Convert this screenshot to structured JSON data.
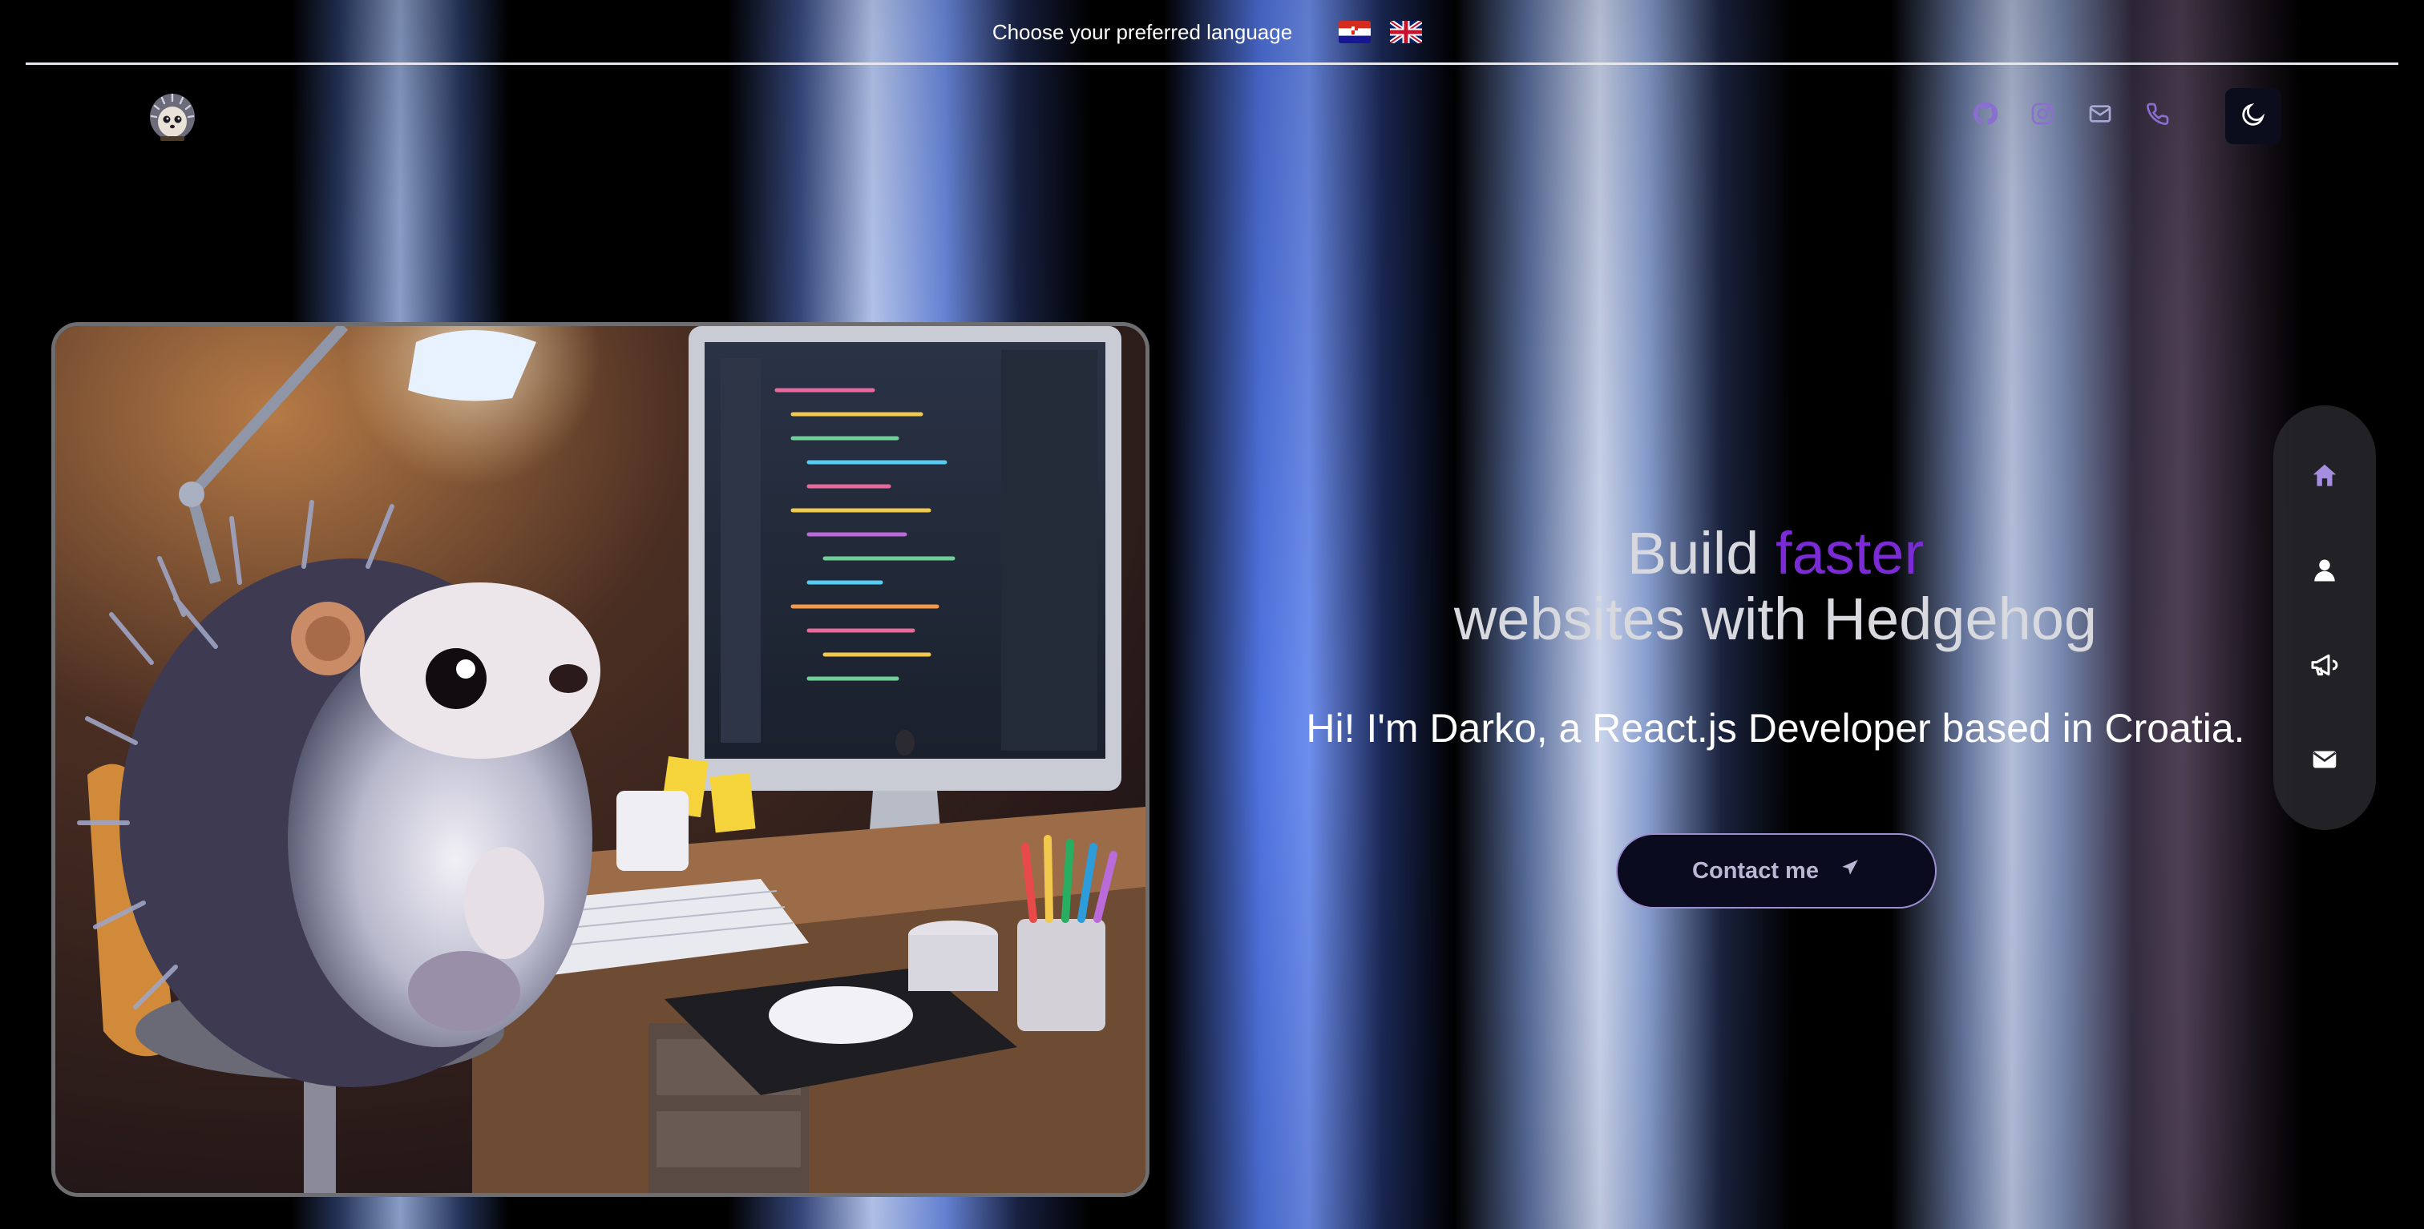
{
  "language_bar": {
    "label": "Choose your preferred language",
    "flags": [
      "croatian-flag",
      "uk-flag"
    ]
  },
  "header": {
    "logo": "hedgehog-logo",
    "social_icons": [
      "github-icon",
      "instagram-icon",
      "mail-icon",
      "phone-icon"
    ],
    "theme_toggle_icon": "moon-icon"
  },
  "hero": {
    "headline_part1": "Build",
    "headline_accent": "faster",
    "headline_part2": "websites with Hedgehog",
    "subheadline": "Hi! I'm Darko, a React.js Developer based in Croatia.",
    "contact_button_label": "Contact me",
    "contact_button_icon": "send-icon"
  },
  "side_nav": {
    "items": [
      "home-icon",
      "user-icon",
      "megaphone-icon",
      "envelope-icon"
    ],
    "active": "home-icon"
  },
  "colors": {
    "accent": "#7b2bd6",
    "button_bg": "#0a0b1e",
    "side_nav_bg": "#2a2a2e"
  }
}
